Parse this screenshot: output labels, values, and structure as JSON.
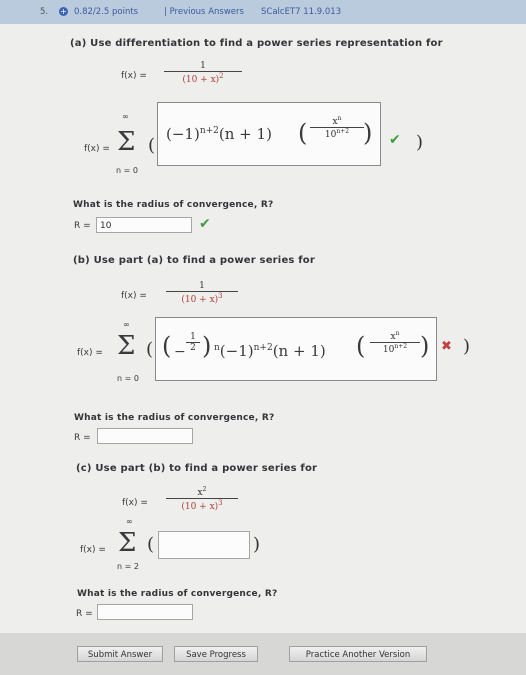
{
  "header": {
    "question_number": "5.",
    "points": "0.82/2.5 points",
    "previous_answers": "| Previous Answers",
    "source": "SCalcET7 11.9.013"
  },
  "part_a": {
    "prompt": "(a) Use differentiation to find a power series representation for",
    "function": "f(x) = 1 / (10 + x)^2",
    "sum_lower": "n = 0",
    "sum_upper": "∞",
    "answer": "(−1)^(n+2)(n+1)(x^n / 10^(n+2))",
    "answer_status": "correct",
    "radius_question": "What is the radius of convergence, R?",
    "radius_label": "R =",
    "radius_value": "10",
    "radius_status": "correct"
  },
  "part_b": {
    "prompt": "(b) Use part (a) to find a power series for",
    "function": "f(x) = 1 / (10 + x)^3",
    "sum_lower": "n = 0",
    "sum_upper": "∞",
    "answer": "(−1/2)^n(−1)^(n+2)(n+1)(x^n / 10^(n+2))",
    "answer_status": "incorrect",
    "radius_question": "What is the radius of convergence, R?",
    "radius_label": "R =",
    "radius_value": ""
  },
  "part_c": {
    "prompt": "(c) Use part (b) to find a power series for",
    "function": "f(x) = x^2 / (10 + x)^3",
    "sum_lower": "n = 2",
    "sum_upper": "∞",
    "answer": "",
    "radius_question": "What is the radius of convergence, R?",
    "radius_label": "R =",
    "radius_value": ""
  },
  "buttons": {
    "submit": "Submit Answer",
    "save": "Save Progress",
    "practice": "Practice Another Version"
  },
  "colors": {
    "header_bg": "#b9cbdc",
    "correct": "#3f9c3f",
    "incorrect": "#c04040",
    "denominator": "#b0413c"
  }
}
